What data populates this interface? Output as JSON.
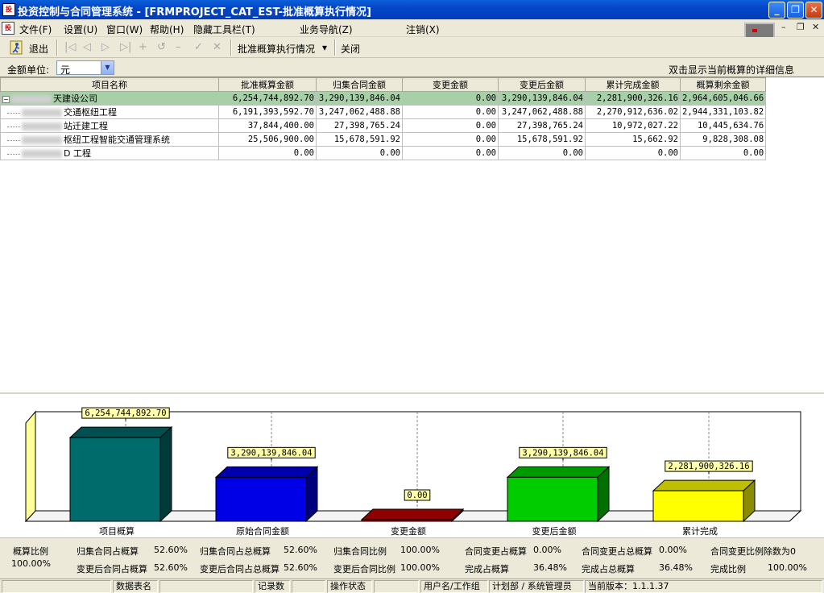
{
  "window": {
    "title": "投资控制与合同管理系统 - [FRMPROJECT_CAT_EST-批准概算执行情况]",
    "app_icon": "app-icon",
    "minimize": "_",
    "restore": "❐",
    "close": "✕"
  },
  "menu": {
    "items": [
      "文件(F)",
      "设置(U)",
      "窗口(W)",
      "帮助(H)",
      "隐藏工具栏(T)",
      "业务导航(Z)",
      "注销(X)"
    ],
    "mdi_controls": [
      "–",
      "❐",
      "✕"
    ]
  },
  "toolbar": {
    "exit_label": "退出",
    "nav_icons": [
      "|◁",
      "◁",
      "▷",
      "▷|",
      "+",
      "↺",
      "–",
      "✓",
      "✕"
    ],
    "report_label": "批准概算执行情况",
    "report_dropdown": "▾",
    "close_label": "关闭"
  },
  "unit": {
    "label": "金额单位:",
    "value": "元",
    "hint": "双击显示当前概算的详细信息"
  },
  "grid": {
    "columns": [
      "项目名称",
      "批准概算金额",
      "归集合同金额",
      "变更金额",
      "变更后金额",
      "累计完成金额",
      "概算剩余金额"
    ],
    "rows": [
      {
        "name": "天建设公司",
        "level": 0,
        "values": [
          "6,254,744,892.70",
          "3,290,139,846.04",
          "0.00",
          "3,290,139,846.04",
          "2,281,900,326.16",
          "2,964,605,046.66"
        ]
      },
      {
        "name": "交通枢纽工程",
        "level": 1,
        "values": [
          "6,191,393,592.70",
          "3,247,062,488.88",
          "0.00",
          "3,247,062,488.88",
          "2,270,912,636.02",
          "2,944,331,103.82"
        ]
      },
      {
        "name": "站迁建工程",
        "level": 1,
        "values": [
          "37,844,400.00",
          "27,398,765.24",
          "0.00",
          "27,398,765.24",
          "10,972,027.22",
          "10,445,634.76"
        ]
      },
      {
        "name": "枢纽工程智能交通管理系统",
        "level": 1,
        "values": [
          "25,506,900.00",
          "15,678,591.92",
          "0.00",
          "15,678,591.92",
          "15,662.92",
          "9,828,308.08"
        ]
      },
      {
        "name": "D 工程",
        "level": 1,
        "values": [
          "0.00",
          "0.00",
          "0.00",
          "0.00",
          "0.00",
          "0.00"
        ]
      }
    ]
  },
  "chart_data": {
    "type": "bar",
    "categories": [
      "项目概算",
      "原始合同金额",
      "变更金额",
      "变更后金额",
      "累计完成"
    ],
    "values": [
      6254744892.7,
      3290139846.04,
      0.0,
      3290139846.04,
      2281900326.16
    ],
    "data_labels": [
      "6,254,744,892.70",
      "3,290,139,846.04",
      "0.00",
      "3,290,139,846.04",
      "2,281,900,326.16"
    ],
    "colors": [
      "#006b6b",
      "#0000e6",
      "#c00000",
      "#00cc00",
      "#ffff00"
    ],
    "ylim": [
      0,
      6500000000
    ],
    "title": "",
    "xlabel": "",
    "ylabel": "",
    "grid": false,
    "legend": "none"
  },
  "stats": {
    "ratio_label": "概算比例",
    "ratio_value": "100.00%",
    "row1": [
      {
        "label": "归集合同占概算",
        "value": "52.60%"
      },
      {
        "label": "归集合同占总概算",
        "value": "52.60%"
      },
      {
        "label": "归集合同比例",
        "value": "100.00%"
      },
      {
        "label": "合同变更占概算",
        "value": "0.00%"
      },
      {
        "label": "合同变更占总概算",
        "value": "0.00%"
      },
      {
        "label": "合同变更比例除数为0",
        "value": ""
      }
    ],
    "row2": [
      {
        "label": "变更后合同占概算",
        "value": "52.60%"
      },
      {
        "label": "变更后合同占总概算",
        "value": "52.60%"
      },
      {
        "label": "变更后合同比例",
        "value": "100.00%"
      },
      {
        "label": "完成占概算",
        "value": "36.48%"
      },
      {
        "label": "完成占总概算",
        "value": "36.48%"
      },
      {
        "label": "完成比例",
        "value": "100.00%"
      }
    ]
  },
  "statusbar": {
    "cells": [
      "",
      "数据表名",
      "",
      "记录数",
      "",
      "操作状态",
      "",
      "用户名/工作组",
      "计划部 / 系统管理员",
      "当前版本：1.1.1.37"
    ]
  }
}
